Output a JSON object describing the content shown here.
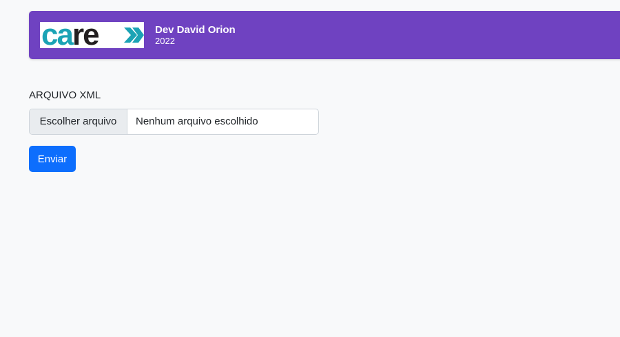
{
  "header": {
    "logo_text": "care",
    "brand_name": "Dev David Orion",
    "year": "2022"
  },
  "form": {
    "label": "ARQUIVO XML",
    "file_button_label": "Escolher arquivo",
    "file_status": "Nenhum arquivo escolhido",
    "submit_label": "Enviar"
  },
  "colors": {
    "header_bg": "#6f42c1",
    "logo_teal": "#1ba3b5",
    "logo_dark": "#231f20",
    "primary_button": "#0d6efd",
    "page_bg": "#f8f9fa"
  },
  "icons": {
    "logo_arrows": "double-chevron-right-icon"
  }
}
